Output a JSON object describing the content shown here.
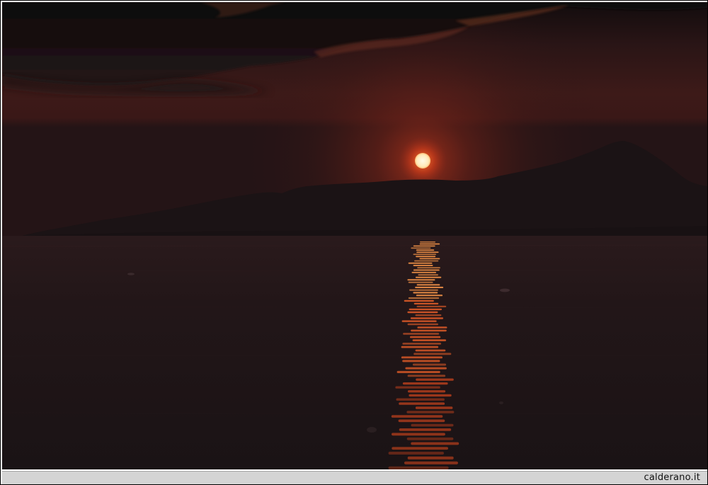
{
  "photo": {
    "scene": "sunset-over-sea",
    "palette": {
      "sky_top": "#140d0e",
      "sky_mid": "#33181a",
      "sky_glow": "#6a1f18",
      "sun": "#fff4e0",
      "sun_halo": "#ff5a1e",
      "mountains": "#1a1214",
      "sea": "#1d1517",
      "reflection": "#ff6a2a"
    }
  },
  "watermark": {
    "text": "calderano.it"
  }
}
